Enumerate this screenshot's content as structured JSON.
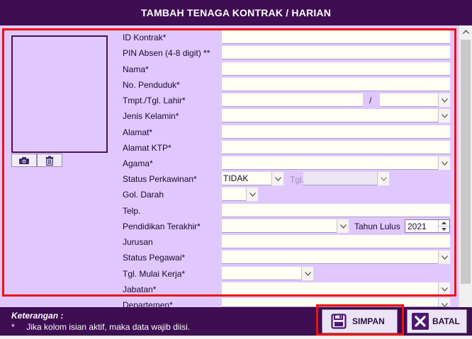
{
  "window": {
    "title": "TAMBAH TENAGA KONTRAK / HARIAN"
  },
  "colors": {
    "header_bg": "#3e0d52",
    "form_bg": "#e0c8ff",
    "input_bg": "#fffff3",
    "highlight_border": "#ee1111"
  },
  "photo": {
    "camera_icon": "camera-icon",
    "delete_icon": "trash-icon"
  },
  "fields": {
    "id_kontrak": "ID Kontrak*",
    "pin_absen": "PIN Absen (4-8 digit) **",
    "nama": "Nama*",
    "no_penduduk": "No. Penduduk*",
    "tmpt_tgl_lahir": "Tmpt./Tgl. Lahir*",
    "tgl_separator": "/",
    "jenis_kelamin": "Jenis Kelamin*",
    "alamat": "Alamat*",
    "alamat_ktp": "Alamat KTP*",
    "agama": "Agama*",
    "status_perkawinan": "Status Perkawinan*",
    "status_perkawinan_value": "TIDAK",
    "tgl_label": "Tgl.",
    "gol_darah": "Gol. Darah",
    "telp": "Telp.",
    "pendidikan_terakhir": "Pendidikan Terakhir*",
    "tahun_lulus_label": "Tahun Lulus",
    "tahun_lulus_value": "2021",
    "jurusan": "Jurusan",
    "status_pegawai": "Status Pegawai*",
    "tgl_mulai_kerja": "Tgl. Mulai Kerja*",
    "jabatan": "Jabatan*",
    "departemen": "Departemen*"
  },
  "footer": {
    "note_title": "Keterangan :",
    "note_bullet": "*",
    "note_text": "Jika kolom isian aktif, maka data wajib diisi.",
    "save_label": "SIMPAN",
    "cancel_label": "BATAL"
  }
}
